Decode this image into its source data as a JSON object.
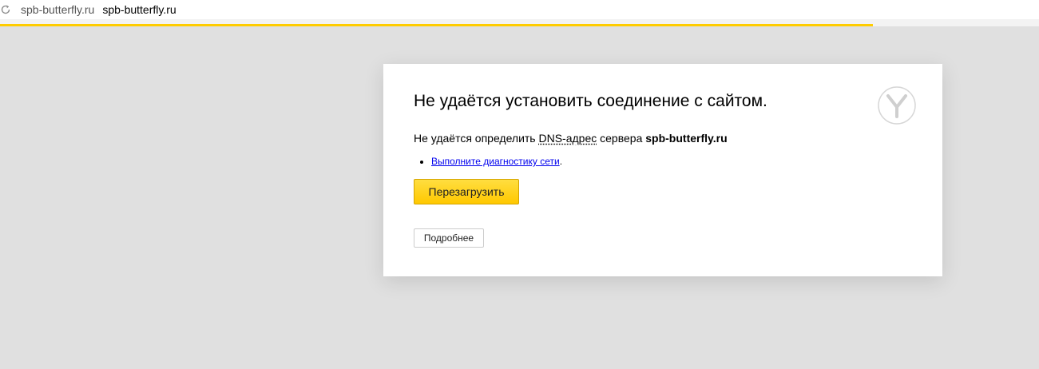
{
  "addressbar": {
    "domain": "spb-butterfly.ru",
    "url": "spb-butterfly.ru"
  },
  "page_load": {
    "progress": 0.84,
    "color": "#ffcc00"
  },
  "error": {
    "title": "Не удаётся установить соединение с сайтом.",
    "desc_prefix": "Не удаётся определить ",
    "dns_term": "DNS-адрес",
    "desc_middle": " сервера ",
    "server": "spb-butterfly.ru",
    "suggestion_link": "Выполните диагностику сети",
    "suggestion_suffix": ".",
    "reload_label": "Перезагрузить",
    "details_label": "Подробнее"
  },
  "colors": {
    "background": "#e0e0e0",
    "accent": "#ffcc00",
    "link": "#0000ee"
  },
  "icons": {
    "reload": "reload-icon",
    "logo": "yandex-browser-logo-icon"
  }
}
